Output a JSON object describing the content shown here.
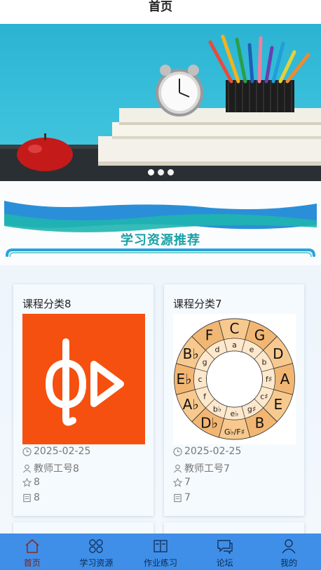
{
  "header": {
    "title": "首页"
  },
  "banner": {
    "slides": 3,
    "active_index": 0
  },
  "section": {
    "title": "学习资源推荐"
  },
  "cards": [
    {
      "title": "课程分类8",
      "date": "2025-02-25",
      "teacher": "教师工号8",
      "stars": "8",
      "count": "8",
      "image": "play-logo"
    },
    {
      "title": "课程分类7",
      "date": "2025-02-25",
      "teacher": "教师工号7",
      "stars": "7",
      "count": "7",
      "image": "circle-of-fifths"
    }
  ],
  "circle_of_fifths": {
    "outer": [
      "C",
      "G",
      "D",
      "A",
      "E",
      "B",
      "G♭/F♯",
      "D♭",
      "A♭",
      "E♭",
      "B♭",
      "F"
    ],
    "inner": [
      "a",
      "e",
      "b",
      "f♯",
      "c♯",
      "g♯",
      "e♭",
      "b♭",
      "f",
      "c",
      "g",
      "d"
    ]
  },
  "tabbar": {
    "items": [
      {
        "label": "首页",
        "icon": "home-icon",
        "active": true
      },
      {
        "label": "学习资源",
        "icon": "grid-icon",
        "active": false
      },
      {
        "label": "作业练习",
        "icon": "book-icon",
        "active": false
      },
      {
        "label": "论坛",
        "icon": "chat-icon",
        "active": false
      },
      {
        "label": "我的",
        "icon": "user-icon",
        "active": false
      }
    ]
  },
  "colors": {
    "tabbar": "#3f8fe8",
    "accent": "#1aa1a6",
    "logo_bg": "#f5500f"
  }
}
